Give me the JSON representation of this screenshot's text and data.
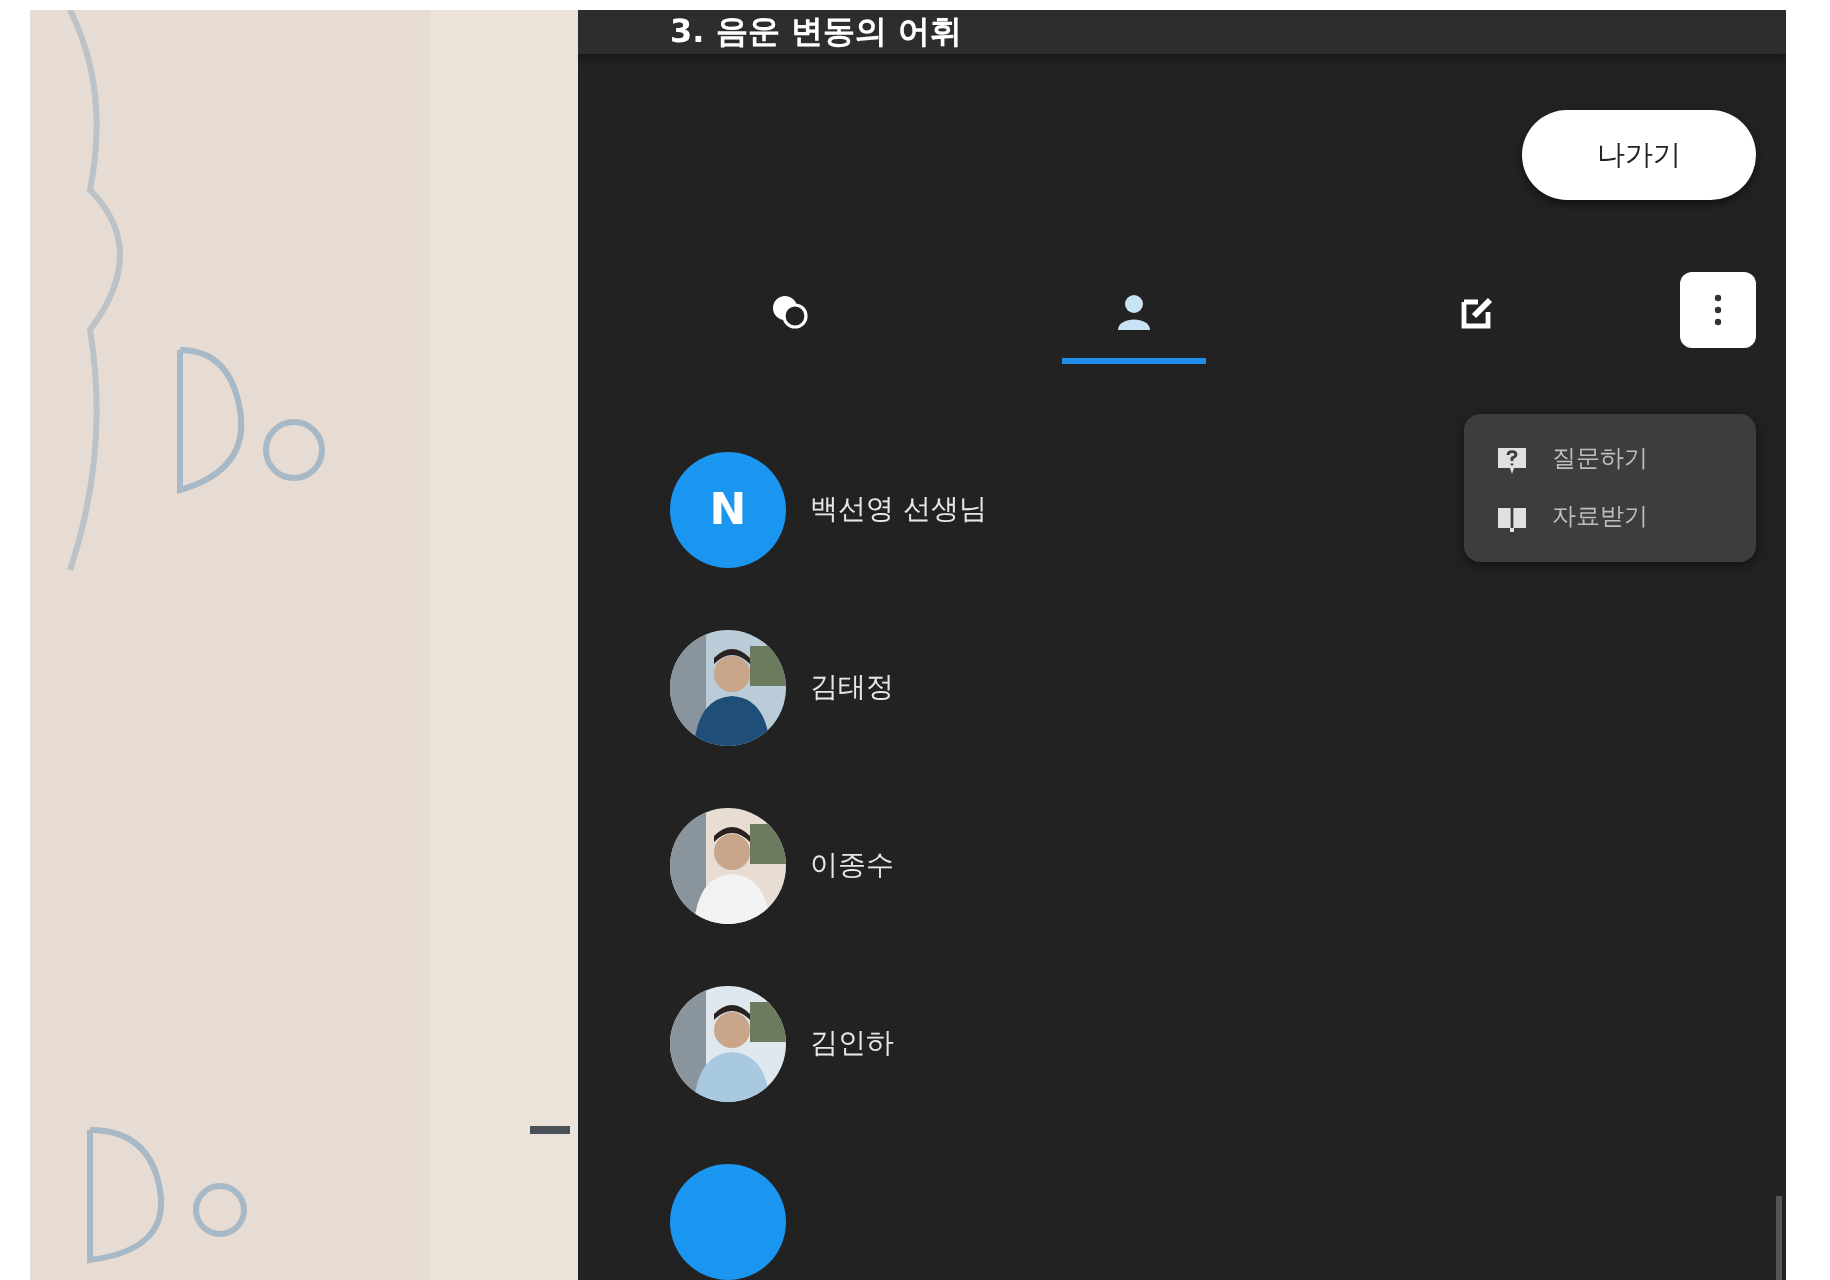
{
  "header": {
    "title": "3. 음운 변동의 어휘"
  },
  "exit_button": {
    "label": "나가기"
  },
  "tabs": [
    {
      "kind": "chat",
      "selected": false
    },
    {
      "kind": "person",
      "selected": true
    },
    {
      "kind": "edit",
      "selected": false
    }
  ],
  "more_menu": {
    "open": true,
    "items": [
      {
        "kind": "question",
        "label": "질문하기"
      },
      {
        "kind": "book",
        "label": "자료받기"
      }
    ]
  },
  "participants": [
    {
      "kind": "initial",
      "initial": "N",
      "name": "백선영 선생님"
    },
    {
      "name": "김태정"
    },
    {
      "name": "이종수"
    },
    {
      "name": "김인하"
    },
    {
      "kind": "initial"
    }
  ]
}
